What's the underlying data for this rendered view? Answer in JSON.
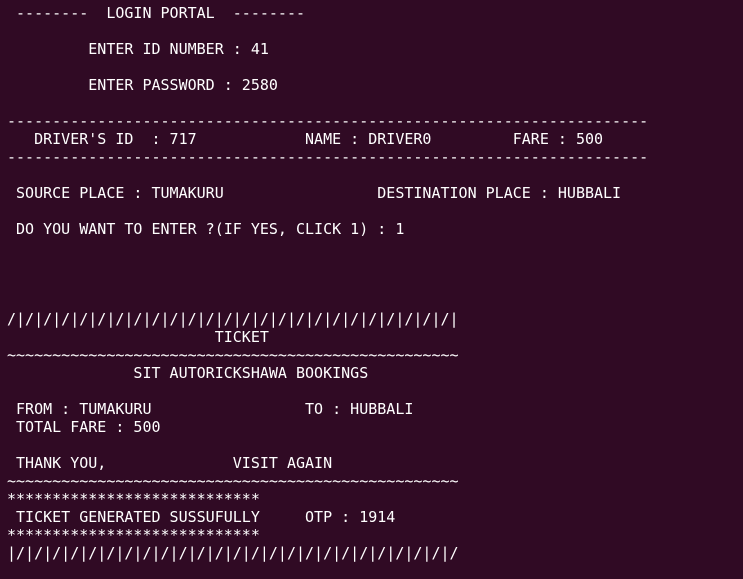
{
  "terminal": {
    "lines": [
      " --------  LOGIN PORTAL  --------",
      "",
      "         ENTER ID NUMBER : 41",
      "",
      "         ENTER PASSWORD : 2580",
      "",
      "-----------------------------------------------------------------------",
      "   DRIVER'S ID  : 717            NAME : DRIVER0         FARE : 500",
      "-----------------------------------------------------------------------",
      "",
      " SOURCE PLACE : TUMAKURU                 DESTINATION PLACE : HUBBALI",
      "",
      " DO YOU WANT TO ENTER ?(IF YES, CLICK 1) : 1",
      "",
      "",
      "",
      "",
      "/|/|/|/|/|/|/|/|/|/|/|/|/|/|/|/|/|/|/|/|/|/|/|/|/|",
      "                       TICKET",
      "~~~~~~~~~~~~~~~~~~~~~~~~~~~~~~~~~~~~~~~~~~~~~~~~~~",
      "              SIT AUTORICKSHAWA BOOKINGS",
      "",
      " FROM : TUMAKURU                 TO : HUBBALI",
      " TOTAL FARE : 500",
      "",
      " THANK YOU,              VISIT AGAIN",
      "~~~~~~~~~~~~~~~~~~~~~~~~~~~~~~~~~~~~~~~~~~~~~~~~~~",
      "****************************",
      " TICKET GENERATED SUSSUFULLY     OTP : 1914",
      "****************************",
      "|/|/|/|/|/|/|/|/|/|/|/|/|/|/|/|/|/|/|/|/|/|/|/|/|/"
    ]
  }
}
